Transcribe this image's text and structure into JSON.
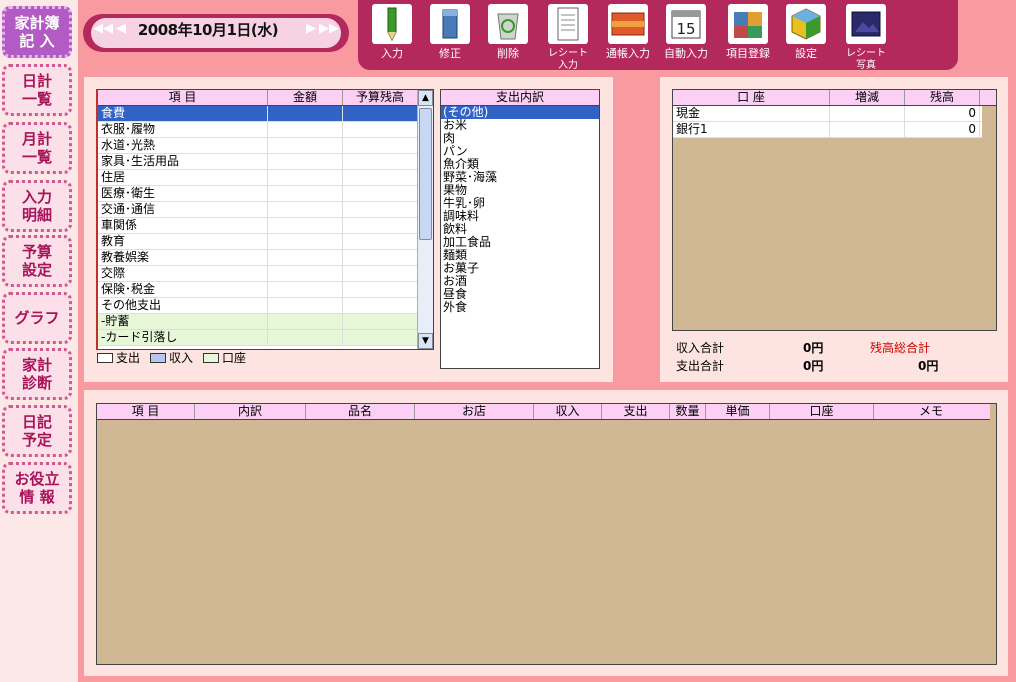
{
  "nav": [
    {
      "label": "家計簿\n記 入",
      "active": true
    },
    {
      "label": "日計\n一覧"
    },
    {
      "label": "月計\n一覧"
    },
    {
      "label": "入力\n明細"
    },
    {
      "label": "予算\n設定"
    },
    {
      "label": "グラフ"
    },
    {
      "label": "家計\n診断"
    },
    {
      "label": "日記\n予定"
    },
    {
      "label": "お役立\n情 報"
    }
  ],
  "date": {
    "text": "2008年10月1日(水)",
    "prev_month": "◀◀",
    "prev_day": "◀",
    "next_day": "▶",
    "next_month": "▶▶"
  },
  "toolbar": [
    {
      "label": "入力",
      "icon": "pencil-icon"
    },
    {
      "label": "修正",
      "icon": "edit-icon"
    },
    {
      "label": "削除",
      "icon": "trash-icon"
    },
    {
      "label": "レシート\n入力",
      "icon": "receipt-icon"
    },
    {
      "label": "通帳入力",
      "icon": "bankbook-icon"
    },
    {
      "label": "自動入力",
      "icon": "calendar-icon"
    },
    {
      "label": "項目登録",
      "icon": "register-icon"
    },
    {
      "label": "設定",
      "icon": "settings-icon"
    },
    {
      "label": "レシート\n写真",
      "icon": "photo-icon"
    }
  ],
  "item_table": {
    "headers": [
      "項 目",
      "金額",
      "予算残高"
    ],
    "rows": [
      {
        "name": "食費",
        "type": "sel"
      },
      {
        "name": "衣服･履物"
      },
      {
        "name": "水道･光熱"
      },
      {
        "name": "家具･生活用品"
      },
      {
        "name": "住居"
      },
      {
        "name": "医療･衛生"
      },
      {
        "name": "交通･通信"
      },
      {
        "name": "車関係"
      },
      {
        "name": "教育"
      },
      {
        "name": "教養娯楽"
      },
      {
        "name": "交際"
      },
      {
        "name": "保険･税金"
      },
      {
        "name": "その他支出"
      },
      {
        "name": "-貯蓄",
        "type": "acct"
      },
      {
        "name": "-カード引落し",
        "type": "acct"
      }
    ]
  },
  "legend": [
    {
      "label": "支出",
      "color": "#ffffff"
    },
    {
      "label": "収入",
      "color": "#b7c6f0"
    },
    {
      "label": "口座",
      "color": "#e6f8d8"
    }
  ],
  "breakdown": {
    "header": "支出内訳",
    "items": [
      "(その他)",
      "お米",
      "肉",
      "パン",
      "魚介類",
      "野菜･海藻",
      "果物",
      "牛乳･卵",
      "調味料",
      "飲料",
      "加工食品",
      "麺類",
      "お菓子",
      "お酒",
      "昼食",
      "外食"
    ]
  },
  "account_table": {
    "headers": [
      "口 座",
      "増減",
      "残高"
    ],
    "rows": [
      {
        "name": "現金",
        "change": "",
        "balance": "0"
      },
      {
        "name": "銀行1",
        "change": "",
        "balance": "0"
      }
    ]
  },
  "totals": {
    "income_label": "収入合計",
    "income_value": "0円",
    "expense_label": "支出合計",
    "expense_value": "0円",
    "balance_label": "残高総合計",
    "balance_value": "0円",
    "balance_color": "#cc0000"
  },
  "detail_table": {
    "headers": [
      "項 目",
      "内訳",
      "品名",
      "お店",
      "収入",
      "支出",
      "数量",
      "単価",
      "口座",
      "メモ"
    ]
  },
  "colors": {
    "background": "#f89aa0",
    "toolbar": "#b4295c",
    "header": "#fcd0f5",
    "selection": "#3163c4",
    "tan": "#d1b894"
  }
}
